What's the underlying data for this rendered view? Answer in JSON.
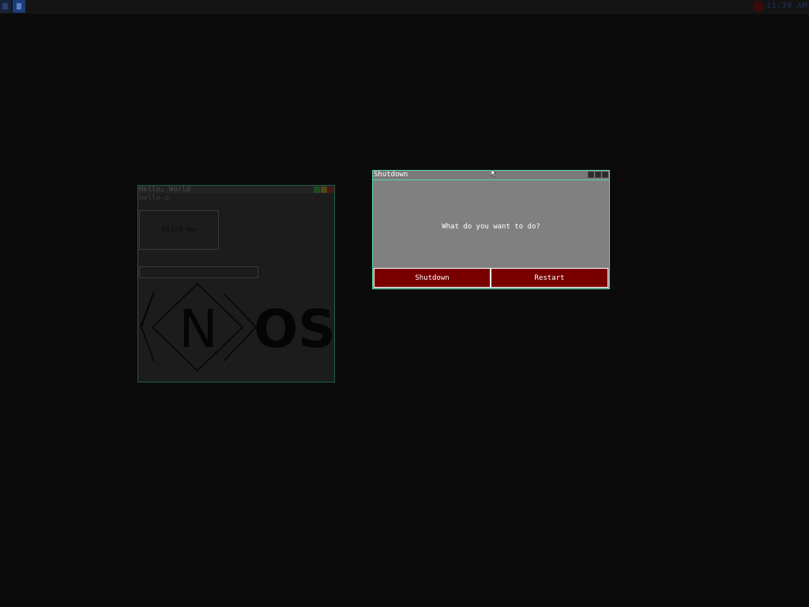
{
  "taskbar": {
    "start_icon": "menu-icon",
    "task_icon": "app-icon",
    "tray_icon": "power-icon",
    "clock": "11:39 AM"
  },
  "background_window": {
    "title": "Hello, World",
    "label": "Hello-o",
    "button_label": "Click me",
    "input_value": "",
    "logo_text": "OS",
    "logo_letter": "N",
    "controls": {
      "min_color": "#1c4d1c",
      "max_color": "#4d4a14",
      "close_color": "#4d1414"
    }
  },
  "dialog": {
    "title": "Shutdown",
    "message": "What do you want to do?",
    "buttons": {
      "shutdown": "Shutdown",
      "restart": "Restart"
    },
    "accent_color": "#55d6a4",
    "button_color": "#7a0000"
  }
}
